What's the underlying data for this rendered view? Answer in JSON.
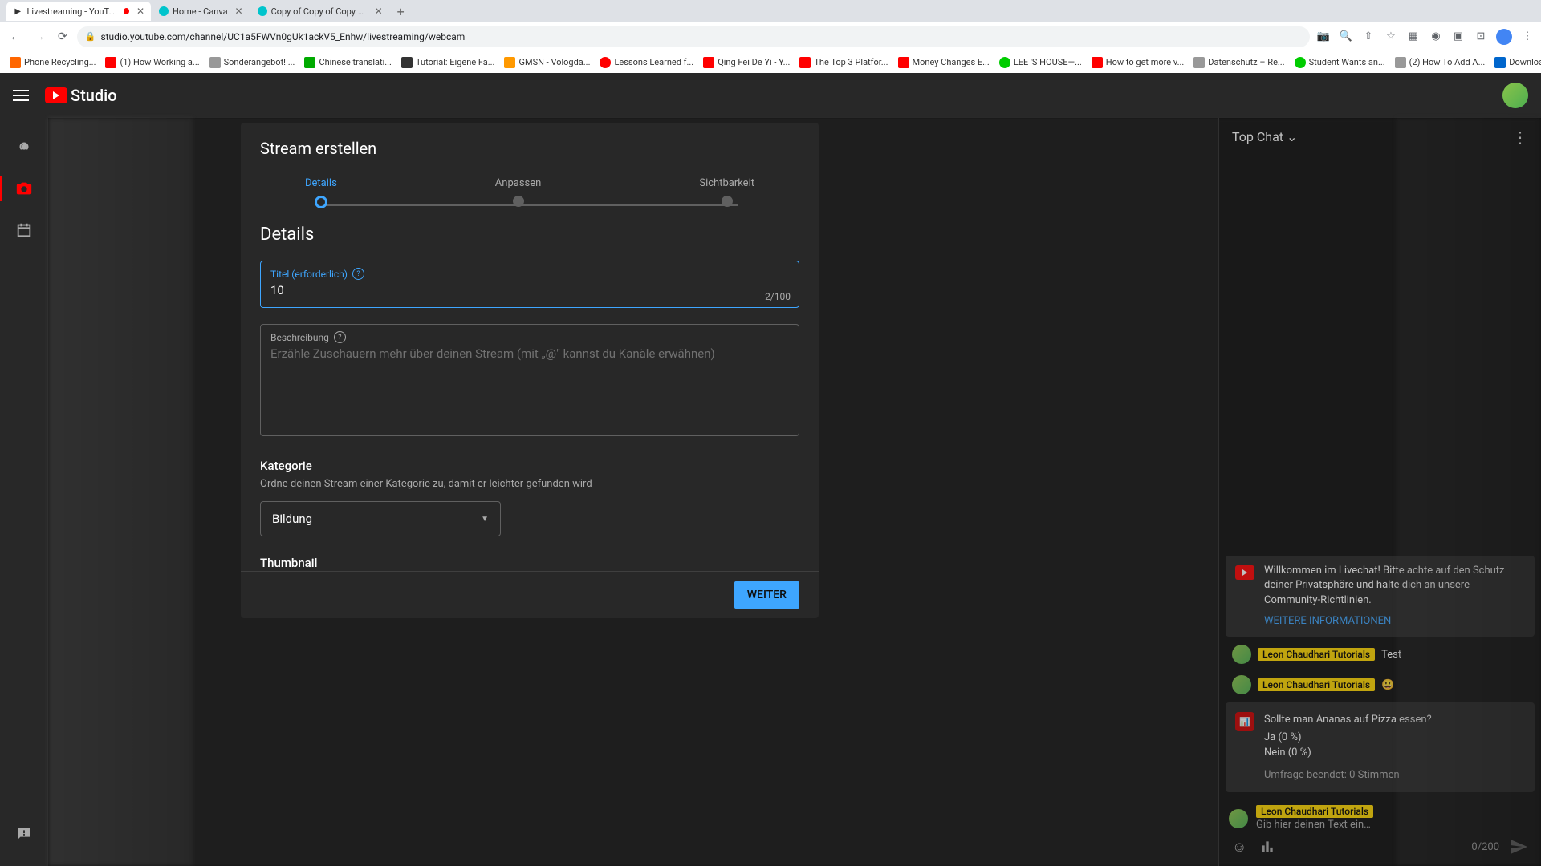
{
  "browser": {
    "tabs": [
      {
        "title": "Livestreaming - YouTube S",
        "active": true
      },
      {
        "title": "Home - Canva",
        "active": false
      },
      {
        "title": "Copy of Copy of Copy of Cop",
        "active": false
      }
    ],
    "url": "studio.youtube.com/channel/UC1a5FWVn0gUk1ackV5_Enhw/livestreaming/webcam",
    "bookmarks": [
      "Phone Recycling...",
      "(1) How Working a...",
      "Sonderangebot! ...",
      "Chinese translati...",
      "Tutorial: Eigene Fa...",
      "GMSN - Vologda...",
      "Lessons Learned f...",
      "Qing Fei De Yi - Y...",
      "The Top 3 Platfor...",
      "Money Changes E...",
      "LEE 'S HOUSE—...",
      "How to get more v...",
      "Datenschutz – Re...",
      "Student Wants an...",
      "(2) How To Add A...",
      "Download - Cooki..."
    ]
  },
  "studio": {
    "logo": "Studio"
  },
  "modal": {
    "title": "Stream erstellen",
    "steps": {
      "details": "Details",
      "anpassen": "Anpassen",
      "sichtbarkeit": "Sichtbarkeit"
    },
    "heading": "Details",
    "title_field": {
      "label": "Titel (erforderlich)",
      "value": "10",
      "count": "2/100"
    },
    "desc_field": {
      "label": "Beschreibung",
      "placeholder": "Erzähle Zuschauern mehr über deinen Stream (mit „@\" kannst du Kanäle erwähnen)"
    },
    "category": {
      "heading": "Kategorie",
      "desc": "Ordne deinen Stream einer Kategorie zu, damit er leichter gefunden wird",
      "value": "Bildung"
    },
    "thumbnail": {
      "heading": "Thumbnail"
    },
    "next_btn": "WEITER"
  },
  "chat": {
    "dropdown": "Top Chat",
    "notice": {
      "text": "Willkommen im Livechat! Bitte achte auf den Schutz deiner Privatsphäre und halte dich an unsere Community-Richtlinien.",
      "link": "WEITERE INFORMATIONEN"
    },
    "messages": [
      {
        "author": "Leon Chaudhari Tutorials",
        "text": "Test"
      },
      {
        "author": "Leon Chaudhari Tutorials",
        "text": "😃"
      }
    ],
    "poll": {
      "question": "Sollte man Ananas auf Pizza essen?",
      "opt1": "Ja (0 %)",
      "opt2": "Nein (0 %)",
      "status": "Umfrage beendet: 0 Stimmen"
    },
    "input": {
      "author": "Leon Chaudhari Tutorials",
      "placeholder": "Gib hier deinen Text ein…",
      "count": "0/200"
    }
  }
}
